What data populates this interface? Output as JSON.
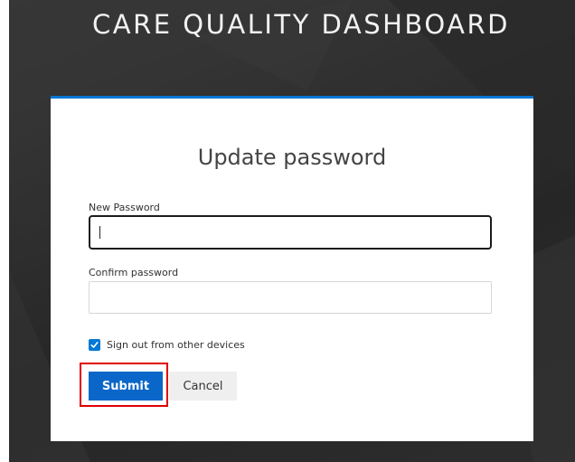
{
  "app": {
    "title": "CARE QUALITY DASHBOARD"
  },
  "dialog": {
    "heading": "Update password",
    "new_password": {
      "label": "New Password",
      "value": "",
      "focused": true
    },
    "confirm_password": {
      "label": "Confirm password",
      "value": ""
    },
    "sign_out_checkbox": {
      "label": "Sign out from other devices",
      "checked": true
    },
    "buttons": {
      "submit_label": "Submit",
      "cancel_label": "Cancel"
    }
  },
  "colors": {
    "accent": "#0078d4",
    "submit_button": "#0a67c9",
    "highlight": "#e00000",
    "background_dark": "#2f2f2f"
  },
  "icons": {
    "checkbox": "checkmark-icon"
  }
}
